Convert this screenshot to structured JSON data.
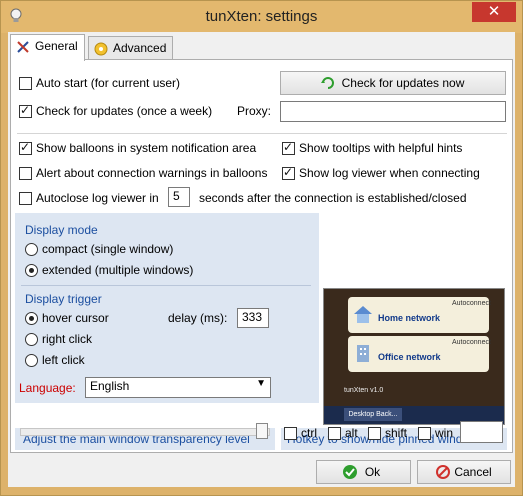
{
  "window": {
    "title": "tunXten: settings",
    "close_label": "✕"
  },
  "tabs": [
    {
      "label": "General",
      "underline": "G"
    },
    {
      "label": "Advanced",
      "underline": "A"
    }
  ],
  "general": {
    "auto_start": {
      "label": "Auto start (for current user)",
      "checked": false
    },
    "check_updates": {
      "label": "Check for updates (once a week)",
      "checked": true
    },
    "check_now_button": "Check for updates now",
    "proxy_label": "Proxy:",
    "proxy_value": "",
    "show_balloons": {
      "label": "Show balloons in system notification area",
      "checked": true
    },
    "show_tooltips": {
      "label": "Show tooltips with helpful hints",
      "checked": true
    },
    "alert_warnings": {
      "label": "Alert about connection warnings in balloons",
      "checked": false
    },
    "show_log_viewer": {
      "label": "Show log viewer when connecting",
      "checked": true
    },
    "autoclose": {
      "label": "Autoclose log viewer in",
      "checked": false,
      "value": "5",
      "suffix": "seconds after the connection is established/closed"
    },
    "display_mode": {
      "title": "Display mode",
      "options": [
        {
          "label": "compact (single window)",
          "checked": false
        },
        {
          "label": "extended (multiple windows)",
          "checked": true
        }
      ]
    },
    "display_trigger": {
      "title": "Display trigger",
      "options": [
        {
          "label": "hover cursor",
          "checked": true
        },
        {
          "label": "right click",
          "checked": false
        },
        {
          "label": "left click",
          "checked": false
        }
      ],
      "delay_label": "delay (ms):",
      "delay_value": "333"
    },
    "language": {
      "label": "Language:",
      "value": "English"
    },
    "transparency": {
      "label": "Adjust the main window transparency level",
      "level": 0.97
    },
    "hotkey": {
      "title": "Hotkey to show/hide pinned windows",
      "ctrl": {
        "label": "ctrl",
        "checked": false
      },
      "alt": {
        "label": "alt",
        "checked": false
      },
      "shift": {
        "label": "shift",
        "checked": false
      },
      "win": {
        "label": "win",
        "checked": false
      },
      "key_value": ""
    },
    "preview": {
      "cards": [
        {
          "name": "Home network",
          "autoconnect": "Autoconnect"
        },
        {
          "name": "Office network",
          "autoconnect": "Autoconnect"
        }
      ],
      "version": "tunXten v1.0",
      "taskbar_button": "Desktop Back..."
    }
  },
  "footer": {
    "ok_label": "Ok",
    "cancel_label": "Cancel"
  },
  "colors": {
    "titlebar": "#e3b86e",
    "accent_blue": "#1c4fa0",
    "section_bg": "#dde6f2",
    "language_label": "#cc0000"
  }
}
